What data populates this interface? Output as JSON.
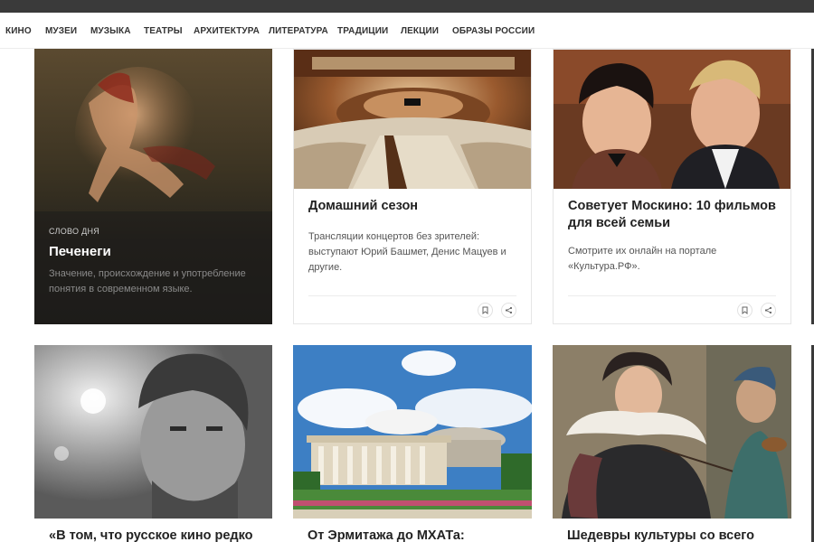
{
  "nav": {
    "items": [
      "Кино",
      "Музеи",
      "Музыка",
      "Театры",
      "Архитектура",
      "Литература",
      "Традиции",
      "Лекции",
      "Образы России"
    ]
  },
  "word_card": {
    "label": "Слово дня",
    "word": "Печенеги",
    "description": "Значение, происхождение и употребление понятия в современном языке."
  },
  "cards": [
    {
      "title": "Домашний сезон",
      "description": "Трансляции концертов без зрителей: выступают Юрий Башмет, Денис Мацуев и другие."
    },
    {
      "title": "Советует Москино: 10 фильмов для всей семьи",
      "description": "Смотрите их онлайн на портале «Культура.РФ»."
    },
    {
      "title": "«В том, что русское кино редко"
    },
    {
      "title": "От Эрмитажа до МХАТа:"
    },
    {
      "title": "Шедевры культуры со всего мира"
    }
  ],
  "icons": {
    "bookmark": "bookmark-icon",
    "share": "share-icon"
  },
  "colors": {
    "topbar": "#3a3a3a",
    "dark_card": "#1d1c1a",
    "sky": "#3d7fc4"
  }
}
